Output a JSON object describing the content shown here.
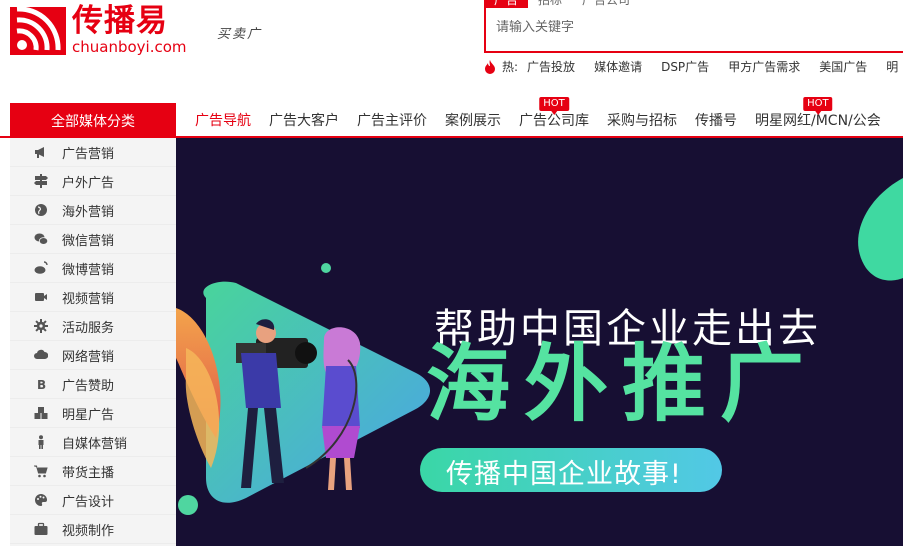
{
  "logo": {
    "cn": "传播易",
    "en": "chuanboyi.com"
  },
  "slogan": "买卖广",
  "search": {
    "tabs": [
      "广告",
      "招标",
      "广告公司"
    ],
    "placeholder": "请输入关键字"
  },
  "hot": {
    "label": "热:",
    "links": [
      "广告投放",
      "媒体邀请",
      "DSP广告",
      "甲方广告需求",
      "美国广告",
      "明"
    ]
  },
  "nav": {
    "all_label": "全部媒体分类",
    "items": [
      {
        "label": "广告导航",
        "hot": ""
      },
      {
        "label": "广告大客户",
        "hot": ""
      },
      {
        "label": "广告主评价",
        "hot": ""
      },
      {
        "label": "案例展示",
        "hot": ""
      },
      {
        "label": "广告公司库",
        "hot": "HOT"
      },
      {
        "label": "采购与招标",
        "hot": ""
      },
      {
        "label": "传播号",
        "hot": ""
      },
      {
        "label": "明星网红/MCN/公会",
        "hot": "HOT"
      }
    ]
  },
  "sidebar": {
    "items": [
      {
        "label": "广告营销",
        "icon": "megaphone-icon"
      },
      {
        "label": "户外广告",
        "icon": "signpost-icon"
      },
      {
        "label": "海外营销",
        "icon": "globe-icon"
      },
      {
        "label": "微信营销",
        "icon": "wechat-icon"
      },
      {
        "label": "微博营销",
        "icon": "weibo-icon"
      },
      {
        "label": "视频营销",
        "icon": "video-camera-icon"
      },
      {
        "label": "活动服务",
        "icon": "gear-icon"
      },
      {
        "label": "网络营销",
        "icon": "cloud-icon"
      },
      {
        "label": "广告赞助",
        "icon": "bitcoin-icon"
      },
      {
        "label": "明星广告",
        "icon": "cubes-icon"
      },
      {
        "label": "自媒体营销",
        "icon": "person-icon"
      },
      {
        "label": "带货主播",
        "icon": "cart-icon"
      },
      {
        "label": "广告设计",
        "icon": "palette-icon"
      },
      {
        "label": "视频制作",
        "icon": "briefcase-icon"
      }
    ]
  },
  "banner": {
    "subtitle": "帮助中国企业走出去",
    "title": "海外推广",
    "pill": "传播中国企业故事!"
  },
  "colors": {
    "brand": "#e60012",
    "banner_bg": "#170f33",
    "banner_green": "#55e3a1"
  }
}
